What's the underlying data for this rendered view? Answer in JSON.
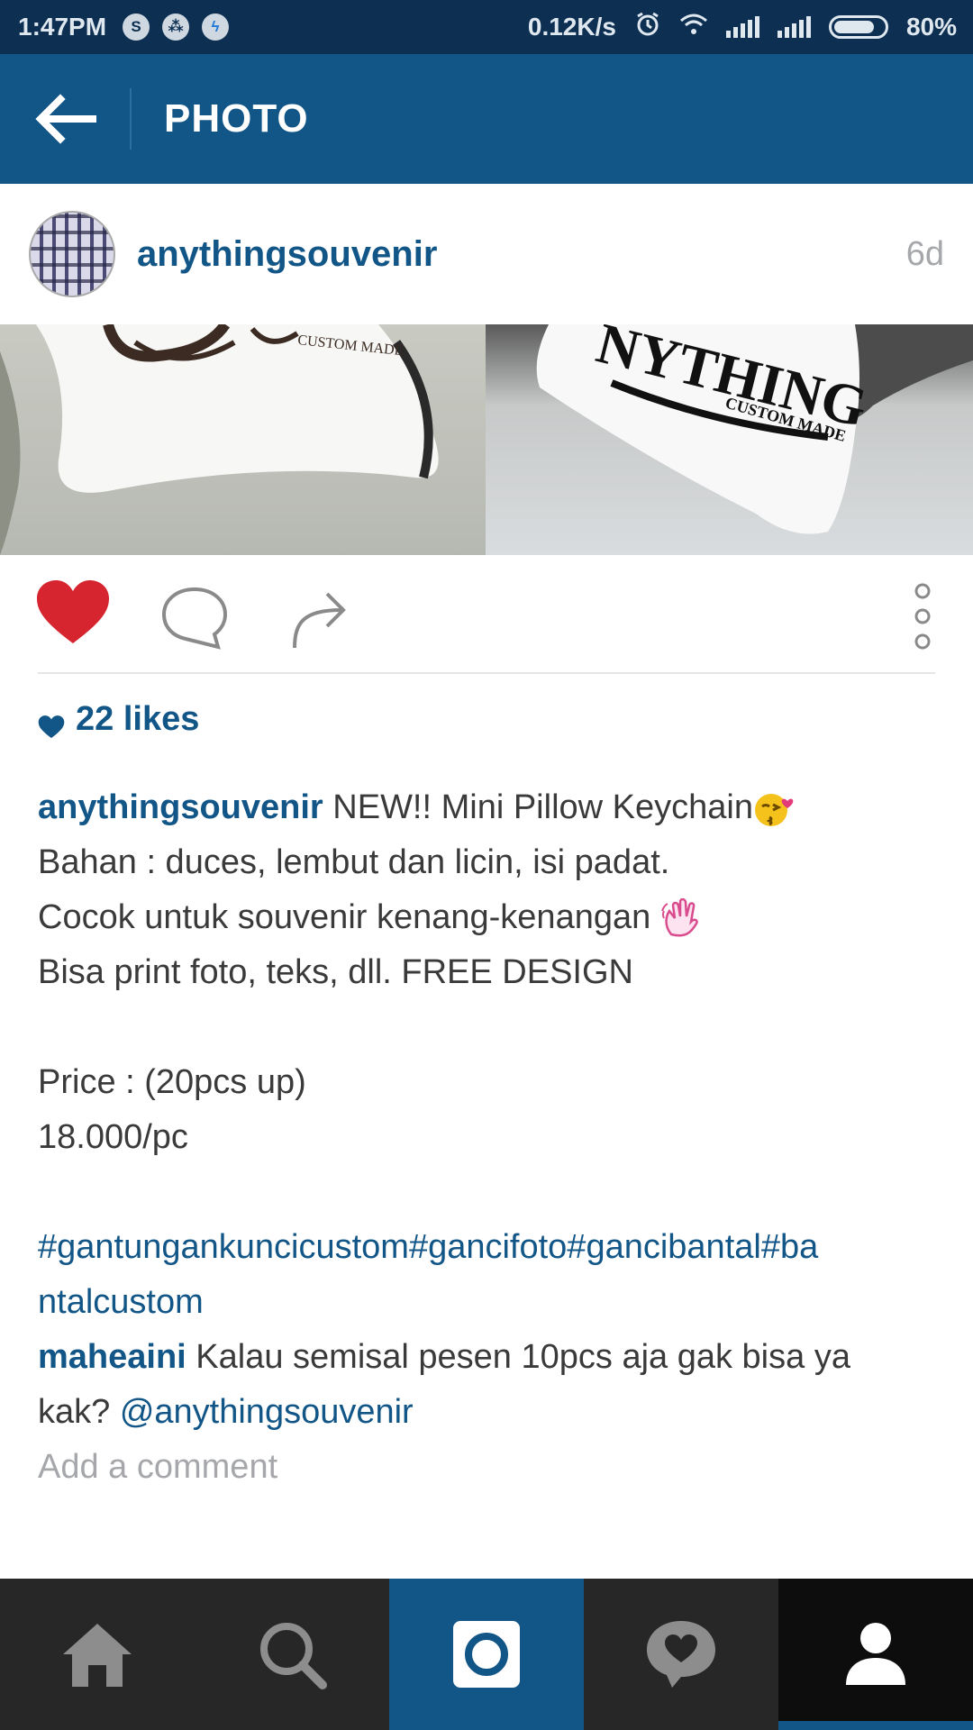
{
  "status_bar": {
    "time": "1:47PM",
    "net_speed": "0.12K/s",
    "battery": "80%",
    "battery_level": 0.8,
    "notification_icons": [
      "skype-icon",
      "bbm-icon",
      "messenger-icon"
    ],
    "system_icons": [
      "alarm-icon",
      "wifi-icon",
      "signal-icon",
      "signal-icon",
      "battery-icon"
    ]
  },
  "app_bar": {
    "title": "PHOTO",
    "back_icon": "back-arrow-icon"
  },
  "post": {
    "username": "anythingsouvenir",
    "time_ago": "6d",
    "photo_left_text": "CUSTOM MADE",
    "photo_right_text_big": "NYTHING",
    "photo_right_text_small": "CUSTOM MADE",
    "likes": "22 likes",
    "caption": {
      "username": "anythingsouvenir",
      "line1": "NEW!! Mini Pillow Keychain",
      "line2": "Bahan : duces, lembut dan licin, isi padat.",
      "line3": "Cocok untuk souvenir kenang-kenangan ",
      "line4": "Bisa print foto, teks, dll. FREE DESIGN",
      "line5": "Price : (20pcs up)",
      "line6": "18.000/pc",
      "hashtags_line1": "#gantungankuncicustom#gancifoto#gancibantal#ba",
      "hashtags_line2": "ntalcustom"
    },
    "comments": [
      {
        "username": "maheaini",
        "text_part1": "Kalau semisal pesen 10pcs aja gak bisa ya",
        "text_part2": "kak? ",
        "mention": "@anythingsouvenir"
      }
    ],
    "add_comment": "Add a comment"
  },
  "colors": {
    "brand": "#125688",
    "status_bar": "#0c2f52",
    "like_red": "#d6252f",
    "muted": "#a5a7aa",
    "nav_bg": "#272727"
  },
  "bottom_nav": {
    "items": [
      "home-icon",
      "search-icon",
      "camera-icon",
      "activity-icon",
      "profile-icon"
    ],
    "active": "profile-icon"
  }
}
